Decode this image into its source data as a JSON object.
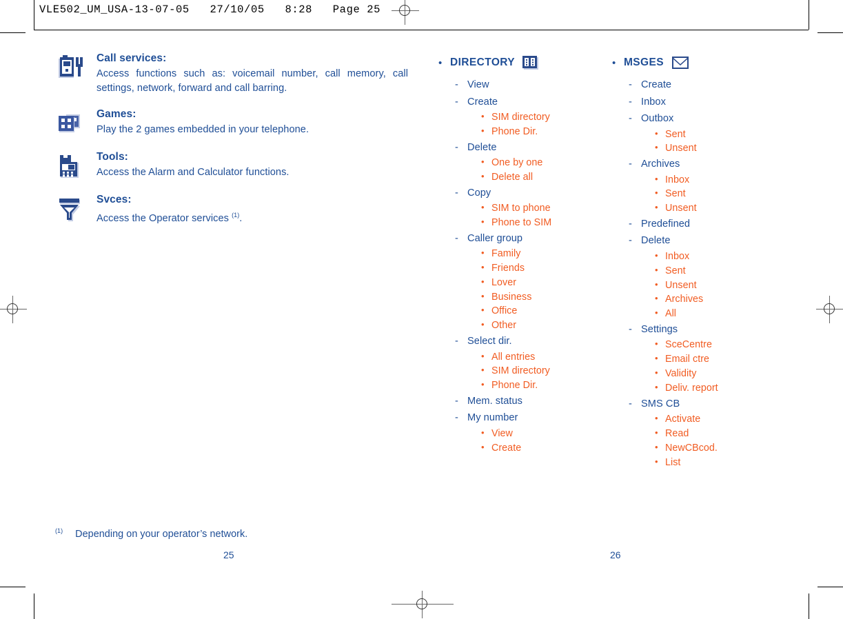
{
  "header": {
    "text": "VLE502_UM_USA-13-07-05   27/10/05   8:28   Page 25"
  },
  "left_column": {
    "features": [
      {
        "icon": "phone-tools-icon",
        "title": "Call services:",
        "body": "Access functions such as: voicemail number, call memory, call settings, network, forward and call barring.",
        "footnote_mark": ""
      },
      {
        "icon": "dice-games-icon",
        "title": "Games:",
        "body": "Play the 2 games embedded in your telephone.",
        "footnote_mark": ""
      },
      {
        "icon": "alarm-calculator-icon",
        "title": "Tools:",
        "body": "Access the Alarm and Calculator functions.",
        "footnote_mark": ""
      },
      {
        "icon": "antenna-services-icon",
        "title": "Svces:",
        "body": "Access the Operator services ",
        "footnote_mark": "(1)",
        "body_tail": "."
      }
    ]
  },
  "directory_menu": {
    "title": "DIRECTORY",
    "icon": "address-book-icon",
    "bullet": "•",
    "items": [
      {
        "label": "View",
        "children": []
      },
      {
        "label": "Create",
        "children": [
          "SIM directory",
          "Phone Dir."
        ]
      },
      {
        "label": "Delete",
        "children": [
          "One by one",
          "Delete all"
        ]
      },
      {
        "label": "Copy",
        "children": [
          "SIM to phone",
          "Phone to SIM"
        ]
      },
      {
        "label": "Caller group",
        "children": [
          "Family",
          "Friends",
          "Lover",
          "Business",
          "Office",
          "Other"
        ]
      },
      {
        "label": "Select dir.",
        "children": [
          "All entries",
          "SIM directory",
          "Phone Dir."
        ]
      },
      {
        "label": "Mem. status",
        "children": []
      },
      {
        "label": "My number",
        "children": [
          "View",
          "Create"
        ]
      }
    ]
  },
  "msges_menu": {
    "title": "MSGES",
    "icon": "envelope-icon",
    "bullet": "•",
    "items": [
      {
        "label": "Create",
        "children": []
      },
      {
        "label": "Inbox",
        "children": []
      },
      {
        "label": "Outbox",
        "children": [
          "Sent",
          "Unsent"
        ]
      },
      {
        "label": "Archives",
        "children": [
          "Inbox",
          "Sent",
          "Unsent"
        ]
      },
      {
        "label": "Predefined",
        "children": []
      },
      {
        "label": "Delete",
        "children": [
          "Inbox",
          "Sent",
          "Unsent",
          "Archives",
          "All"
        ]
      },
      {
        "label": "Settings",
        "children": [
          "SceCentre",
          "Email ctre",
          "Validity",
          "Deliv. report"
        ]
      },
      {
        "label": "SMS CB",
        "children": [
          "Activate",
          "Read",
          "NewCBcod.",
          "List"
        ]
      }
    ]
  },
  "footnote": {
    "mark": "(1)",
    "text": "Depending on your operator’s network."
  },
  "page_numbers": {
    "left": "25",
    "right": "26"
  },
  "colors": {
    "navy": "#1F4E96",
    "orange": "#F15C22",
    "icon_navy": "#2A4A8B",
    "icon_light": "#C3CCE4"
  },
  "marks": {
    "dash": "-"
  }
}
